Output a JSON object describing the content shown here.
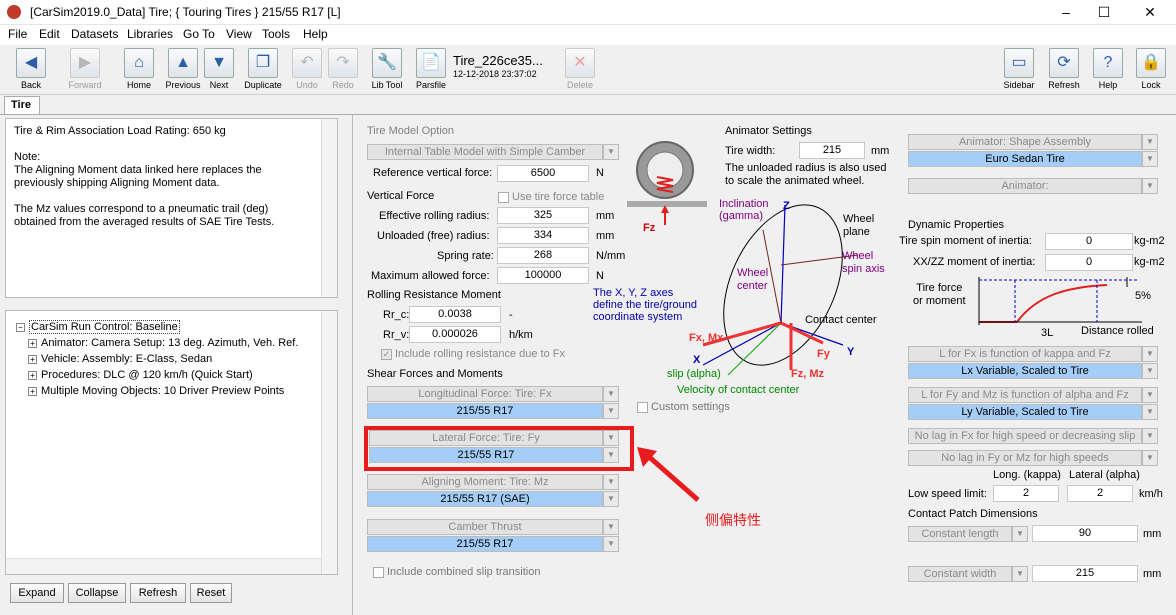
{
  "window": {
    "title": "[CarSim2019.0_Data] Tire; { Touring Tires } 215/55 R17 [L]",
    "min": "–",
    "max": "☐",
    "close": "✕"
  },
  "menu": [
    "File",
    "Edit",
    "Datasets",
    "Libraries",
    "Go To",
    "View",
    "Tools",
    "Help"
  ],
  "toolbar": {
    "back": "Back",
    "forward": "Forward",
    "home": "Home",
    "previous": "Previous",
    "next": "Next",
    "duplicate": "Duplicate",
    "undo": "Undo",
    "redo": "Redo",
    "lib_tool": "Lib Tool",
    "parsfile": "Parsfile",
    "dataset_name": "Tire_226ce35...",
    "dataset_date": "12-12-2018 23:37:02",
    "delete": "Delete",
    "sidebar": "Sidebar",
    "refresh": "Refresh",
    "help": "Help",
    "lock": "Lock"
  },
  "tab": "Tire",
  "notes": "Tire & Rim Association Load Rating: 650 kg\n\nNote:\nThe Aligning Moment data linked here replaces the\npreviously shipping Aligning Moment data.\n\nThe Mz values correspond to a pneumatic trail (deg)\nobtained from the averaged results of SAE Tire Tests.",
  "tree": {
    "root": "CarSim Run Control: Baseline",
    "items": [
      "Animator: Camera Setup: 13 deg. Azimuth, Veh. Ref.",
      "Vehicle: Assembly: E-Class, Sedan",
      "Procedures: DLC @ 120 km/h (Quick Start)",
      "Multiple Moving Objects: 10 Driver Preview Points"
    ]
  },
  "bottom_buttons": [
    "Expand",
    "Collapse",
    "Refresh",
    "Reset"
  ],
  "tire_model": {
    "header": "Tire Model Option",
    "option": "Internal Table Model with Simple Camber",
    "ref_vert_force_label": "Reference vertical force:",
    "ref_vert_force": "6500",
    "ref_vert_force_unit": "N"
  },
  "vertical_force": {
    "header": "Vertical Force",
    "use_table": "Use tire force table",
    "rows": [
      {
        "label": "Effective rolling radius:",
        "value": "325",
        "unit": "mm"
      },
      {
        "label": "Unloaded (free) radius:",
        "value": "334",
        "unit": "mm"
      },
      {
        "label": "Spring rate:",
        "value": "268",
        "unit": "N/mm"
      },
      {
        "label": "Maximum allowed force:",
        "value": "100000",
        "unit": "N"
      }
    ]
  },
  "rolling_resistance": {
    "header": "Rolling Resistance Moment",
    "rr_c_label": "Rr_c:",
    "rr_c": "0.0038",
    "rr_c_unit": "-",
    "rr_v_label": "Rr_v:",
    "rr_v": "0.000026",
    "rr_v_unit": "h/km",
    "include": "Include rolling resistance due to Fx"
  },
  "shear": {
    "header": "Shear Forces and Moments",
    "longitudinal_label": "Longitudinal Force: Tire: Fx",
    "longitudinal_value": "215/55 R17",
    "lateral_label": "Lateral Force: Tire: Fy",
    "lateral_value": "215/55 R17",
    "aligning_label": "Aligning Moment: Tire: Mz",
    "aligning_value": "215/55 R17 (SAE)",
    "camber_label": "Camber Thrust",
    "camber_value": "215/55 R17",
    "combined": "Include combined slip transition"
  },
  "annotation_text": "侧偏特性",
  "diagram": {
    "fz": "Fz",
    "inclination": "Inclination\n(gamma)",
    "z": "Z",
    "wheel_plane": "Wheel\nplane",
    "wheel_center": "Wheel\ncenter",
    "spin_axis": "Wheel\nspin axis",
    "axes_note": "The X, Y, Z axes\ndefine the tire/ground\ncoordinate system",
    "contact_center": "Contact center",
    "fx_mx": "Fx, Mx",
    "x": "X",
    "fy": "Fy",
    "y": "Y",
    "fz_mz": "Fz, Mz",
    "slip": "slip (alpha)",
    "velocity": "Velocity of contact center",
    "custom": "Custom settings"
  },
  "animator": {
    "header": "Animator Settings",
    "width_label": "Tire width:",
    "width": "215",
    "width_unit": "mm",
    "note": "The unloaded radius is also used\nto scale the animated wheel.",
    "shape_label": "Animator: Shape Assembly",
    "shape_value": "Euro Sedan Tire",
    "animator_label": "Animator:"
  },
  "dynamic": {
    "header": "Dynamic Properties",
    "spin_label": "Tire spin moment of inertia:",
    "spin": "0",
    "spin_unit": "kg-m2",
    "xx_label": "XX/ZZ moment of inertia:",
    "xx": "0",
    "xx_unit": "kg-m2",
    "tf_label": "Tire force\nor moment",
    "pct": "5%",
    "three_l": "3L",
    "dist": "Distance rolled",
    "lfx_label": "L for Fx is function of kappa and Fz",
    "lfx_value": "Lx Variable, Scaled to Tire",
    "lfy_label": "L for Fy and Mz is function of alpha and Fz",
    "lfy_value": "Ly Variable, Scaled to Tire",
    "nolag_fx": "No lag in Fx for high speed or decreasing slip",
    "nolag_fy": "No lag in Fy or Mz for high speeds",
    "long_hdr": "Long. (kappa)",
    "lat_hdr": "Lateral (alpha)",
    "low_speed_label": "Low speed limit:",
    "long_val": "2",
    "lat_val": "2",
    "speed_unit": "km/h"
  },
  "contact_patch": {
    "header": "Contact Patch Dimensions",
    "length_label": "Constant length",
    "length": "90",
    "length_unit": "mm",
    "width_label": "Constant width",
    "width": "215",
    "width_unit": "mm"
  }
}
